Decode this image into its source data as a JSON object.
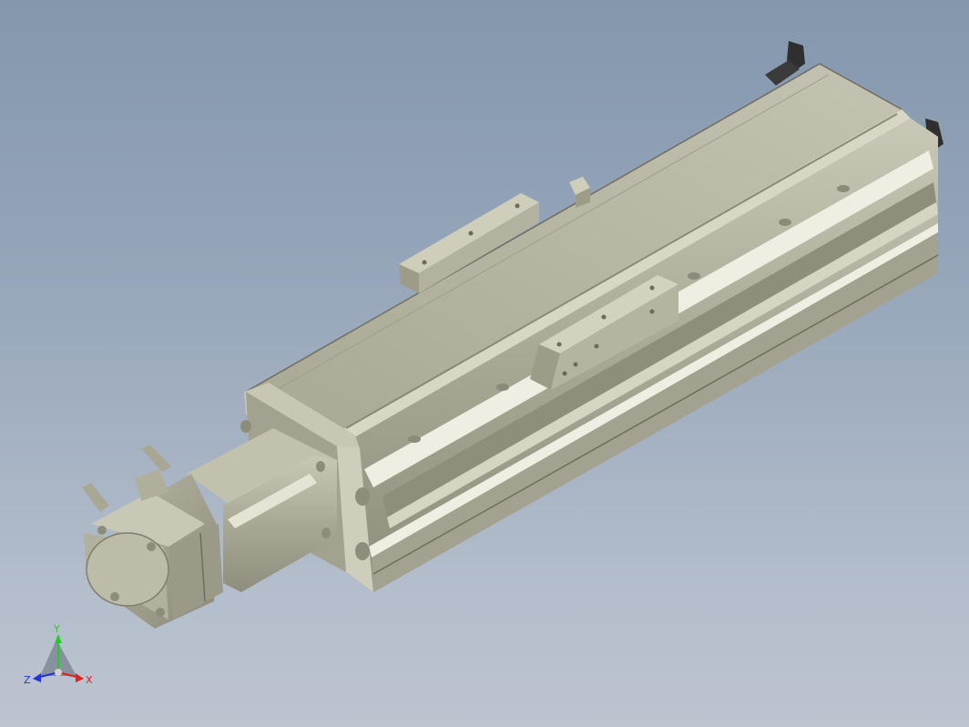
{
  "viewport": {
    "background_top": "#8497ad",
    "background_bottom": "#bcc4d0"
  },
  "model": {
    "body_color": "#b7b6a3",
    "shadow_color": "#8e8d7c",
    "highlight_color": "#dcdccd",
    "dark_edge_color": "#5b5a4e"
  },
  "triad": {
    "y_label": "Y",
    "x_label": "X",
    "z_label": "Z",
    "y_color": "#22cc22",
    "x_color": "#dd2222",
    "z_color": "#2233dd"
  }
}
